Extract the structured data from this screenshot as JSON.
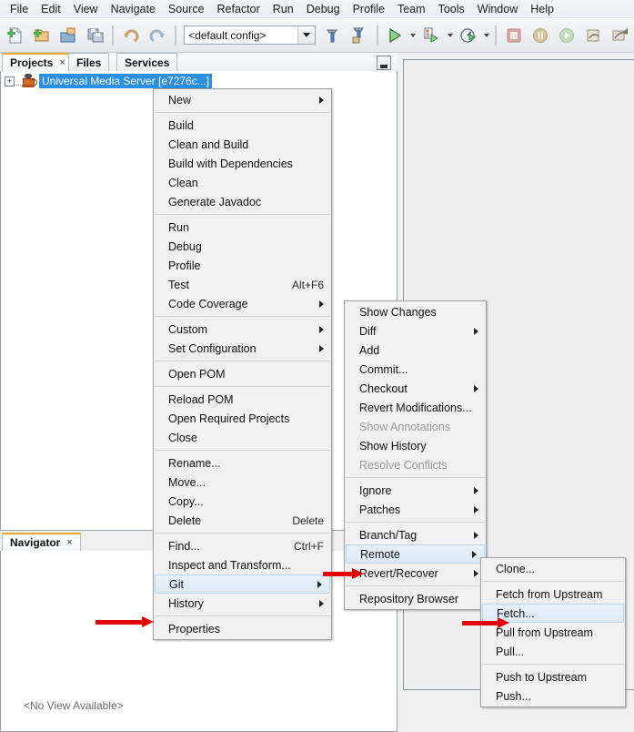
{
  "menubar": {
    "items": [
      {
        "label": "File"
      },
      {
        "label": "Edit"
      },
      {
        "label": "View"
      },
      {
        "label": "Navigate"
      },
      {
        "label": "Source"
      },
      {
        "label": "Refactor"
      },
      {
        "label": "Run"
      },
      {
        "label": "Debug"
      },
      {
        "label": "Profile"
      },
      {
        "label": "Team"
      },
      {
        "label": "Tools"
      },
      {
        "label": "Window"
      },
      {
        "label": "Help"
      }
    ]
  },
  "toolbar": {
    "config_value": "<default config>",
    "buttons": [
      {
        "name": "new-file-icon"
      },
      {
        "name": "new-project-icon"
      },
      {
        "name": "open-project-icon"
      },
      {
        "name": "save-all-icon"
      },
      {
        "name": "undo-icon"
      },
      {
        "name": "redo-icon"
      },
      {
        "name": "build-project-icon"
      },
      {
        "name": "clean-and-build-icon"
      },
      {
        "name": "run-project-icon"
      },
      {
        "name": "debug-project-icon"
      },
      {
        "name": "profile-project-icon"
      },
      {
        "name": "stop-icon"
      },
      {
        "name": "pause-icon"
      },
      {
        "name": "continue-icon"
      },
      {
        "name": "step-over-icon"
      },
      {
        "name": "step-into-icon"
      }
    ]
  },
  "left_dock": {
    "tabs": [
      {
        "label": "Projects",
        "closable": true,
        "active": true
      },
      {
        "label": "Files",
        "closable": false,
        "active": false
      },
      {
        "label": "Services",
        "closable": false,
        "active": false
      }
    ],
    "close_glyph": "×",
    "minimize_name": "minimize-window-button",
    "tree": {
      "expander_glyph": "+",
      "node_label": "Universal Media Server [e7276c...]",
      "node_icon": "maven-project-icon"
    },
    "navigator": {
      "tabs": [
        {
          "label": "Navigator",
          "closable": true,
          "active": true
        }
      ]
    }
  },
  "editor": {
    "placeholder": "<No View Available>"
  },
  "menus": {
    "project_context": {
      "name": "project-context-menu",
      "items": [
        {
          "label": "New",
          "submenu": true
        },
        {
          "separator": true
        },
        {
          "label": "Build"
        },
        {
          "label": "Clean and Build"
        },
        {
          "label": "Build with Dependencies"
        },
        {
          "label": "Clean"
        },
        {
          "label": "Generate Javadoc"
        },
        {
          "separator": true
        },
        {
          "label": "Run"
        },
        {
          "label": "Debug"
        },
        {
          "label": "Profile"
        },
        {
          "label": "Test",
          "accel": "Alt+F6"
        },
        {
          "label": "Code Coverage",
          "submenu": true
        },
        {
          "separator": true
        },
        {
          "label": "Custom",
          "submenu": true
        },
        {
          "label": "Set Configuration",
          "submenu": true
        },
        {
          "separator": true
        },
        {
          "label": "Open POM"
        },
        {
          "separator": true
        },
        {
          "label": "Reload POM"
        },
        {
          "label": "Open Required Projects"
        },
        {
          "label": "Close"
        },
        {
          "separator": true
        },
        {
          "label": "Rename..."
        },
        {
          "label": "Move..."
        },
        {
          "label": "Copy..."
        },
        {
          "label": "Delete",
          "accel": "Delete"
        },
        {
          "separator": true
        },
        {
          "label": "Find...",
          "accel": "Ctrl+F"
        },
        {
          "label": "Inspect and Transform..."
        },
        {
          "label": "Git",
          "submenu": true,
          "highlighted": true
        },
        {
          "label": "History",
          "submenu": true
        },
        {
          "separator": true
        },
        {
          "label": "Properties"
        }
      ]
    },
    "git_submenu": {
      "name": "git-submenu",
      "items": [
        {
          "label": "Show Changes"
        },
        {
          "label": "Diff",
          "submenu": true
        },
        {
          "label": "Add"
        },
        {
          "label": "Commit..."
        },
        {
          "label": "Checkout",
          "submenu": true
        },
        {
          "label": "Revert Modifications..."
        },
        {
          "label": "Show Annotations",
          "disabled": true
        },
        {
          "label": "Show History"
        },
        {
          "label": "Resolve Conflicts",
          "disabled": true
        },
        {
          "separator": true
        },
        {
          "label": "Ignore",
          "submenu": true
        },
        {
          "label": "Patches",
          "submenu": true
        },
        {
          "separator": true
        },
        {
          "label": "Branch/Tag",
          "submenu": true
        },
        {
          "label": "Remote",
          "submenu": true,
          "highlighted": true
        },
        {
          "label": "Revert/Recover",
          "submenu": true
        },
        {
          "separator": true
        },
        {
          "label": "Repository Browser"
        }
      ]
    },
    "remote_submenu": {
      "name": "remote-submenu",
      "items": [
        {
          "label": "Clone..."
        },
        {
          "separator": true
        },
        {
          "label": "Fetch from Upstream"
        },
        {
          "label": "Fetch...",
          "highlighted": true
        },
        {
          "label": "Pull from Upstream"
        },
        {
          "label": "Pull..."
        },
        {
          "separator": true
        },
        {
          "label": "Push to Upstream"
        },
        {
          "label": "Push..."
        }
      ]
    }
  },
  "annotations": {
    "arrow_color": "#e40000",
    "arrows": [
      {
        "name": "arrow-pointing-to-git",
        "target": "Git"
      },
      {
        "name": "arrow-pointing-to-remote",
        "target": "Remote"
      },
      {
        "name": "arrow-pointing-to-fetch",
        "target": "Fetch..."
      }
    ]
  }
}
